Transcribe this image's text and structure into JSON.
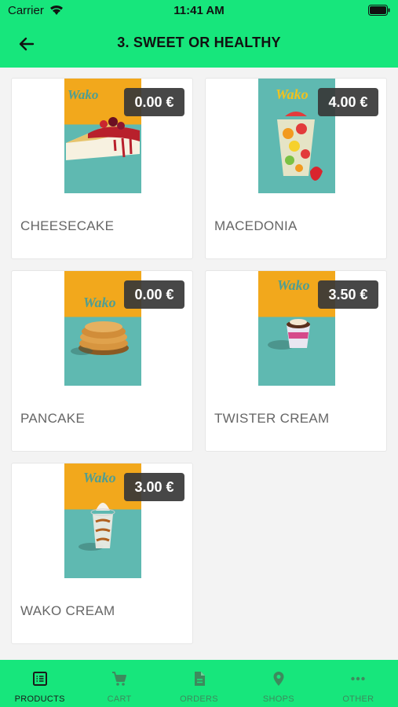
{
  "status_bar": {
    "carrier": "Carrier",
    "time": "11:41 AM"
  },
  "header": {
    "title": "3. SWEET OR HEALTHY"
  },
  "products": [
    {
      "name": "CHEESECAKE",
      "price": "0.00 €",
      "brand": "Wako"
    },
    {
      "name": "MACEDONIA",
      "price": "4.00 €",
      "brand": "Wako"
    },
    {
      "name": "PANCAKE",
      "price": "0.00 €",
      "brand": "Wako"
    },
    {
      "name": "TWISTER CREAM",
      "price": "3.50 €",
      "brand": "Wako"
    },
    {
      "name": "WAKO CREAM",
      "price": "3.00 €",
      "brand": "Wako"
    }
  ],
  "tabs": [
    {
      "label": "PRODUCTS",
      "icon": "list-icon",
      "active": true
    },
    {
      "label": "CART",
      "icon": "cart-icon",
      "active": false
    },
    {
      "label": "ORDERS",
      "icon": "document-icon",
      "active": false
    },
    {
      "label": "SHOPS",
      "icon": "map-pin-icon",
      "active": false
    },
    {
      "label": "OTHER",
      "icon": "more-icon",
      "active": false
    }
  ],
  "colors": {
    "accent": "#17e67c",
    "price_badge": "#373737",
    "photo_orange": "#f2a81c",
    "photo_teal": "#5fb9b1"
  }
}
